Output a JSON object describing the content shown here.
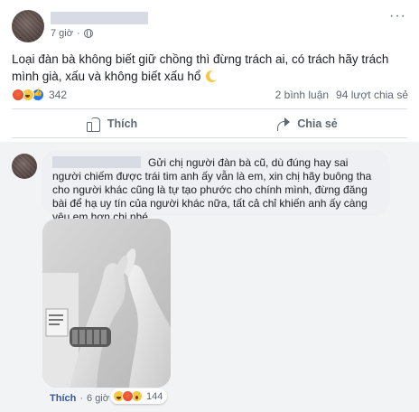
{
  "post": {
    "time": "7 giờ",
    "privacy_icon": "globe-icon",
    "more_label": "···",
    "text": "Loại đàn bà không biết giữ chồng thì đừng trách ai, có trách hãy trách mình già, xấu và không biết xấu hổ",
    "reactions": {
      "icons": [
        "angry-icon",
        "haha-icon",
        "like-icon"
      ],
      "count": "342"
    },
    "comments_count": "2 bình luận",
    "shares_count": "94 lượt chia sẻ"
  },
  "actions": {
    "like_label": "Thích",
    "share_label": "Chia sẻ"
  },
  "comment": {
    "text": "Gửi chị người đàn bà cũ, dù đúng hay sai người chiếm được trái tim anh ấy vẫn là em, xin chị hãy buông tha cho người khác cũng là tự tạo phước cho chính mình, đừng đăng bài để hạ uy tín của người khác nữa, tất cả chỉ khiến anh ấy càng yêu em hơn chị nhé",
    "like_label": "Thích",
    "separator": "·",
    "time": "6 giờ",
    "reactions": {
      "icons": [
        "haha-icon",
        "angry-icon",
        "wow-icon"
      ],
      "count": "144"
    }
  },
  "colors": {
    "link_blue": "#385898",
    "meta_gray": "#606770",
    "divider": "#dadde1",
    "comment_bg": "#f2f3f5"
  }
}
